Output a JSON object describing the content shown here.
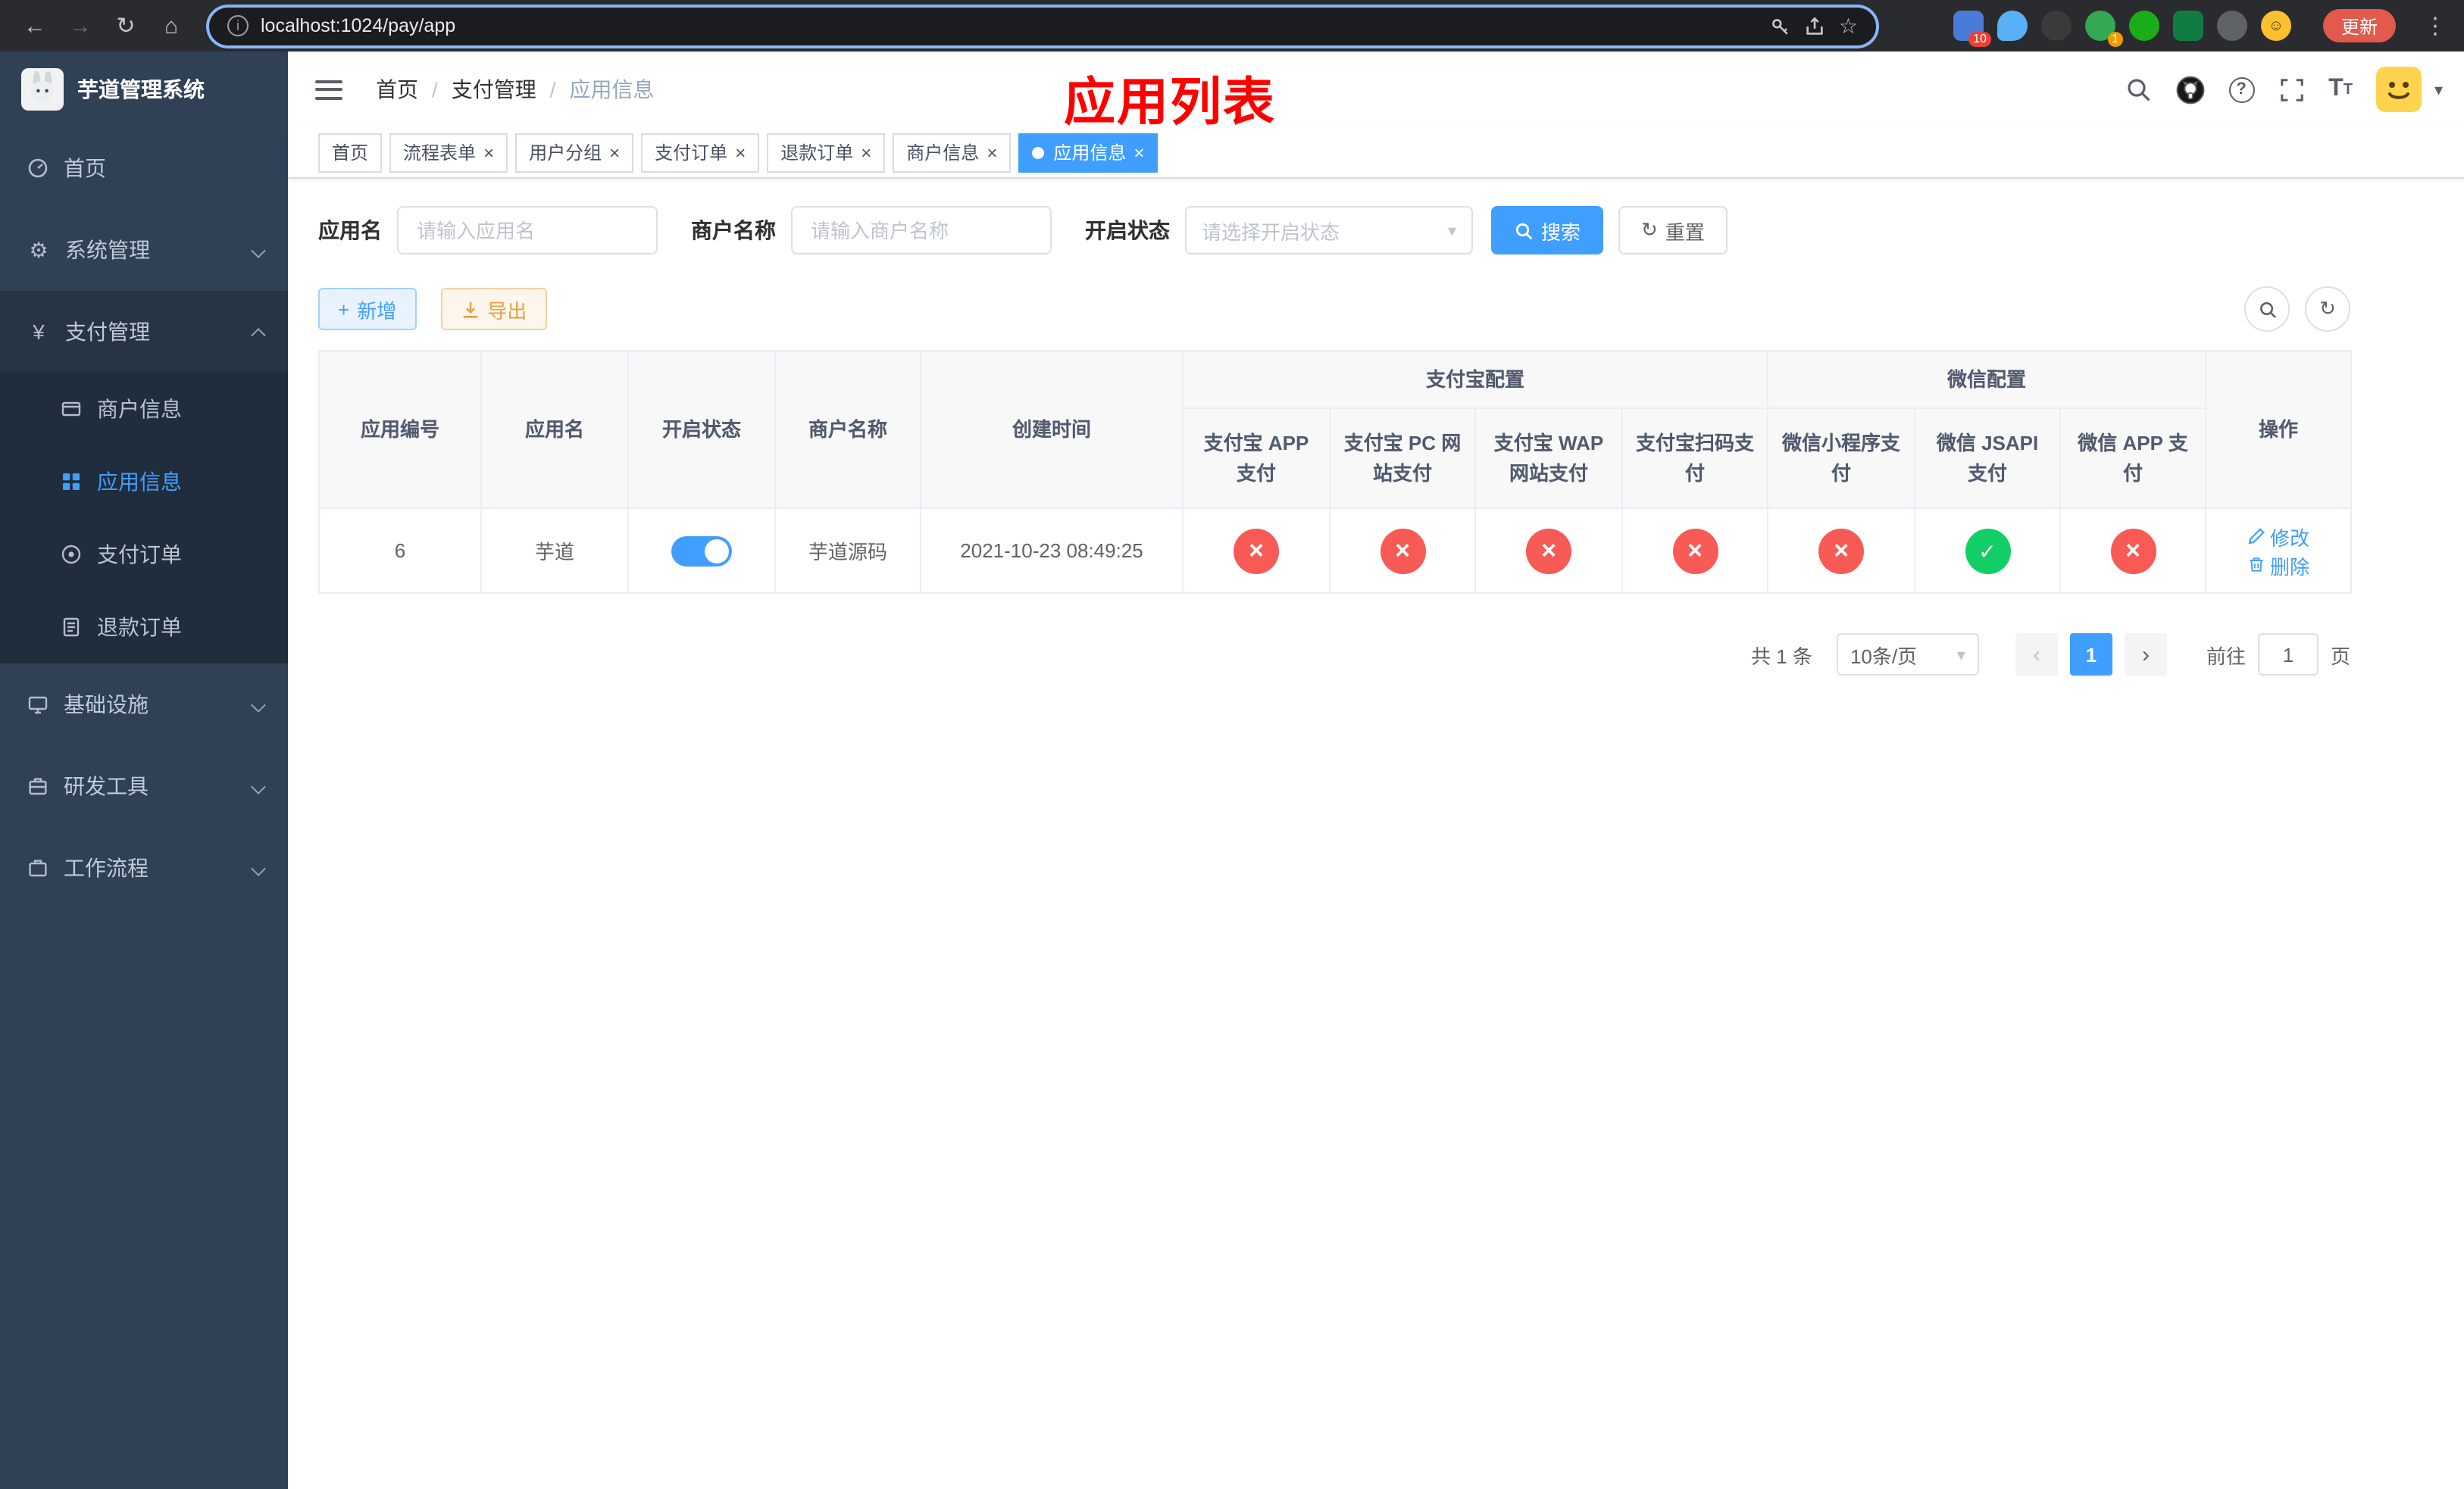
{
  "colors": {
    "primary": "#409EFF",
    "success": "#13ce66",
    "danger": "#f85a55",
    "warning": "#e6a23c",
    "annotation_red": "#ff0000",
    "sidebar_bg": "#304156",
    "sidebar_submenu_bg": "#1f2d3d"
  },
  "browser": {
    "url": "localhost:1024/pay/app",
    "update_button": "更新",
    "ext_badge_1": "10",
    "ext_badge_2": "1"
  },
  "icons": {
    "back": "←",
    "forward": "→",
    "refresh": "↻",
    "home": "⌂",
    "info": "i",
    "dots": "⋮",
    "star": "☆",
    "gear": "⚙",
    "yen": "¥",
    "plus": "+",
    "close": "×",
    "check": "✓",
    "cross": "×",
    "prev": "‹",
    "next": "›",
    "caret": "▾",
    "question": "?",
    "font_big": "T",
    "font_small": "T"
  },
  "sidebar": {
    "logo_title": "芋道管理系统",
    "items": [
      {
        "label": "首页"
      },
      {
        "label": "系统管理"
      },
      {
        "label": "支付管理",
        "children": [
          {
            "label": "商户信息"
          },
          {
            "label": "应用信息"
          },
          {
            "label": "支付订单"
          },
          {
            "label": "退款订单"
          }
        ]
      },
      {
        "label": "基础设施"
      },
      {
        "label": "研发工具"
      },
      {
        "label": "工作流程"
      }
    ]
  },
  "header": {
    "breadcrumb": [
      "首页",
      "支付管理",
      "应用信息"
    ],
    "annotation": "应用列表"
  },
  "tabs": [
    {
      "label": "首页"
    },
    {
      "label": "流程表单"
    },
    {
      "label": "用户分组"
    },
    {
      "label": "支付订单"
    },
    {
      "label": "退款订单"
    },
    {
      "label": "商户信息"
    },
    {
      "label": "应用信息"
    }
  ],
  "filters": {
    "app_name_label": "应用名",
    "app_name_placeholder": "请输入应用名",
    "merchant_label": "商户名称",
    "merchant_placeholder": "请输入商户名称",
    "status_label": "开启状态",
    "status_placeholder": "请选择开启状态",
    "search_button": "搜索",
    "reset_button": "重置"
  },
  "toolbar": {
    "add_button": "新增",
    "export_button": "导出"
  },
  "table": {
    "group_headers": {
      "alipay": "支付宝配置",
      "wechat": "微信配置"
    },
    "columns": [
      "应用编号",
      "应用名",
      "开启状态",
      "商户名称",
      "创建时间",
      "支付宝 APP 支付",
      "支付宝 PC 网站支付",
      "支付宝 WAP 网站支付",
      "支付宝扫码支付",
      "微信小程序支付",
      "微信 JSAPI 支付",
      "微信 APP 支付",
      "操作"
    ],
    "rows": [
      {
        "id": "6",
        "name": "芋道",
        "enabled": true,
        "merchant": "芋道源码",
        "created_at": "2021-10-23 08:49:25",
        "configs": [
          "no",
          "no",
          "no",
          "no",
          "no",
          "yes",
          "no"
        ],
        "edit_label": "修改",
        "delete_label": "删除"
      }
    ]
  },
  "pagination": {
    "total": "共 1 条",
    "page_size": "10条/页",
    "page": "1",
    "goto_label": "前往",
    "goto_value": "1",
    "unit_label": "页"
  }
}
